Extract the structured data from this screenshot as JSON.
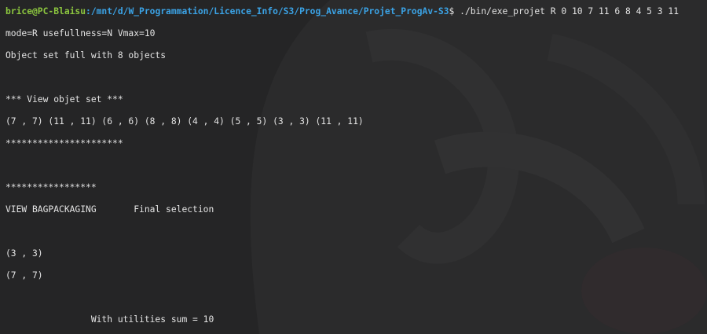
{
  "colors": {
    "background": "#252526",
    "prompt_user": "#8cc63f",
    "prompt_path": "#3ba3e6",
    "text": "#e4e4e4"
  },
  "prompt": {
    "user_host": "brice@PC-Blaisu",
    "path": ":/mnt/d/W_Programmation/Licence_Info/S3/Prog_Avance/Projet_ProgAv-S3",
    "symbol": "$ ",
    "command": "./bin/exe_projet R 0 10 7 11 6 8 4 5 3 11"
  },
  "output": [
    "mode=R usefullness=N Vmax=10",
    "Object set full with 8 objects",
    "",
    "*** View objet set ***",
    "(7 , 7) (11 , 11) (6 , 6) (8 , 8) (4 , 4) (5 , 5) (3 , 3) (11 , 11)",
    "**********************",
    "",
    "*****************",
    "VIEW BAGPACKAGING       Final selection",
    "",
    "(3 , 3)",
    "(7 , 7)",
    "",
    "                With utilities sum = 10"
  ]
}
